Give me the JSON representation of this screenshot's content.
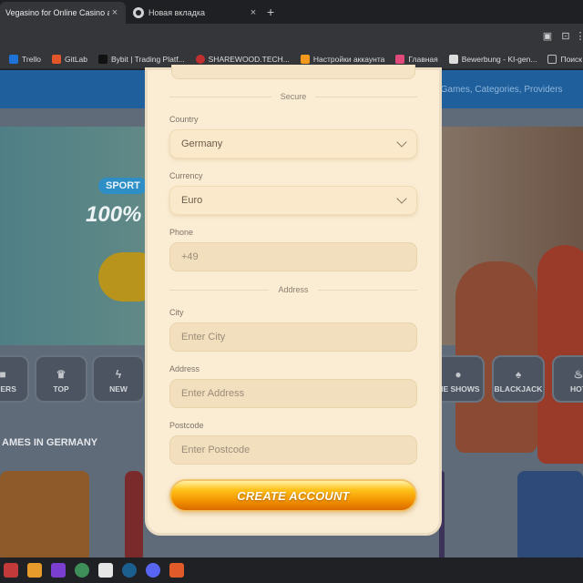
{
  "browser": {
    "tabs": [
      {
        "title": "Vegasino for Online Casino and",
        "active": true
      },
      {
        "title": "Новая вкладка",
        "active": false
      }
    ],
    "new_tab_symbol": "+",
    "close_symbol": "×",
    "bookmarks": [
      {
        "label": "Trello",
        "color": "#1f73d8"
      },
      {
        "label": "GitLab",
        "color": "#e2562a"
      },
      {
        "label": "Bybit | Trading Platf...",
        "color": "#111111"
      },
      {
        "label": "SHAREWOOD.TECH...",
        "color": "#c0302f"
      },
      {
        "label": "Настройки аккаунта",
        "color": "#f39a1e"
      },
      {
        "label": "Главная",
        "color": "#e04a7a"
      },
      {
        "label": "Bewerbung - KI-gen...",
        "color": "#dddddd"
      },
      {
        "label": "Поиск работы",
        "color": "#bdbdbd"
      }
    ]
  },
  "site": {
    "search_placeholder": "Games, Categories, Providers",
    "hero_badge": "SPORT",
    "hero_big": "100%",
    "categories": [
      "NDERS",
      "TOP",
      "NEW",
      "ME SHOWS",
      "BLACKJACK",
      "HOT"
    ],
    "section_title": "AMES IN GERMANY"
  },
  "form": {
    "secure_divider": "Secure",
    "country": {
      "label": "Country",
      "value": "Germany"
    },
    "currency": {
      "label": "Currency",
      "value": "Euro"
    },
    "phone": {
      "label": "Phone",
      "value": "+49"
    },
    "address_divider": "Address",
    "city": {
      "label": "City",
      "placeholder": "Enter City"
    },
    "address": {
      "label": "Address",
      "placeholder": "Enter Address"
    },
    "postcode": {
      "label": "Postcode",
      "placeholder": "Enter Postcode"
    },
    "submit_label": "CREATE ACCOUNT"
  },
  "colors": {
    "modal_bg": "#fbedd4",
    "button_orange": "#f29100",
    "site_blue": "#1f5f9c"
  }
}
